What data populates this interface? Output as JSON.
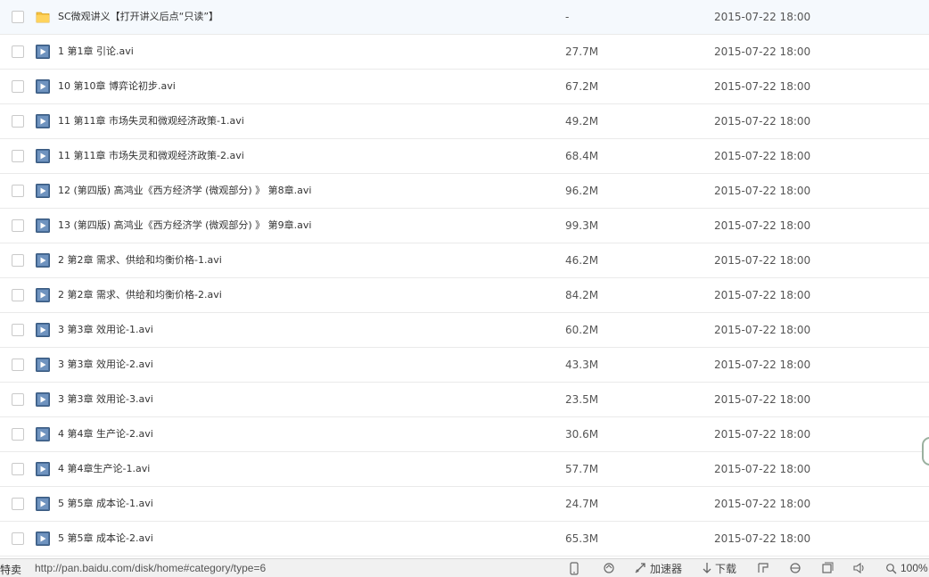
{
  "files": [
    {
      "name": "SC微观讲义【打开讲义后点“只读”】",
      "size": "-",
      "date": "2015-07-22 18:00",
      "icon": "folder-icon"
    },
    {
      "name": "1 第1章 引论.avi",
      "size": "27.7M",
      "date": "2015-07-22 18:00",
      "icon": "video-icon"
    },
    {
      "name": "10 第10章 博弈论初步.avi",
      "size": "67.2M",
      "date": "2015-07-22 18:00",
      "icon": "video-icon"
    },
    {
      "name": "11 第11章 市场失灵和微观经济政策-1.avi",
      "size": "49.2M",
      "date": "2015-07-22 18:00",
      "icon": "video-icon"
    },
    {
      "name": "11 第11章 市场失灵和微观经济政策-2.avi",
      "size": "68.4M",
      "date": "2015-07-22 18:00",
      "icon": "video-icon"
    },
    {
      "name": "12 (第四版) 高鸿业《西方经济学 (微观部分) 》 第8章.avi",
      "size": "96.2M",
      "date": "2015-07-22 18:00",
      "icon": "video-icon"
    },
    {
      "name": "13 (第四版) 高鸿业《西方经济学 (微观部分) 》 第9章.avi",
      "size": "99.3M",
      "date": "2015-07-22 18:00",
      "icon": "video-icon"
    },
    {
      "name": "2 第2章 需求、供给和均衡价格-1.avi",
      "size": "46.2M",
      "date": "2015-07-22 18:00",
      "icon": "video-icon"
    },
    {
      "name": "2 第2章 需求、供给和均衡价格-2.avi",
      "size": "84.2M",
      "date": "2015-07-22 18:00",
      "icon": "video-icon"
    },
    {
      "name": "3 第3章 效用论-1.avi",
      "size": "60.2M",
      "date": "2015-07-22 18:00",
      "icon": "video-icon"
    },
    {
      "name": "3 第3章 效用论-2.avi",
      "size": "43.3M",
      "date": "2015-07-22 18:00",
      "icon": "video-icon"
    },
    {
      "name": "3 第3章 效用论-3.avi",
      "size": "23.5M",
      "date": "2015-07-22 18:00",
      "icon": "video-icon"
    },
    {
      "name": "4 第4章 生产论-2.avi",
      "size": "30.6M",
      "date": "2015-07-22 18:00",
      "icon": "video-icon"
    },
    {
      "name": "4 第4章生产论-1.avi",
      "size": "57.7M",
      "date": "2015-07-22 18:00",
      "icon": "video-icon"
    },
    {
      "name": "5 第5章 成本论-1.avi",
      "size": "24.7M",
      "date": "2015-07-22 18:00",
      "icon": "video-icon"
    },
    {
      "name": "5 第5章 成本论-2.avi",
      "size": "65.3M",
      "date": "2015-07-22 18:00",
      "icon": "video-icon"
    }
  ],
  "status_bar": {
    "left_text": "特卖",
    "url": "http://pan.baidu.com/disk/home#category/type=6",
    "accelerator_label": "加速器",
    "download_label": "下载",
    "zoom": "100%",
    "icons": [
      "phone-icon",
      "refresh-icon",
      "accelerator-icon",
      "download-icon",
      "bookmark-icon",
      "ie-icon",
      "window-icon",
      "speaker-icon",
      "zoom-icon"
    ]
  },
  "colors": {
    "folder": "#f5c242",
    "video": "#4a6f9b",
    "row_border": "#eaeaea",
    "status_bg": "#f1f1f1"
  }
}
